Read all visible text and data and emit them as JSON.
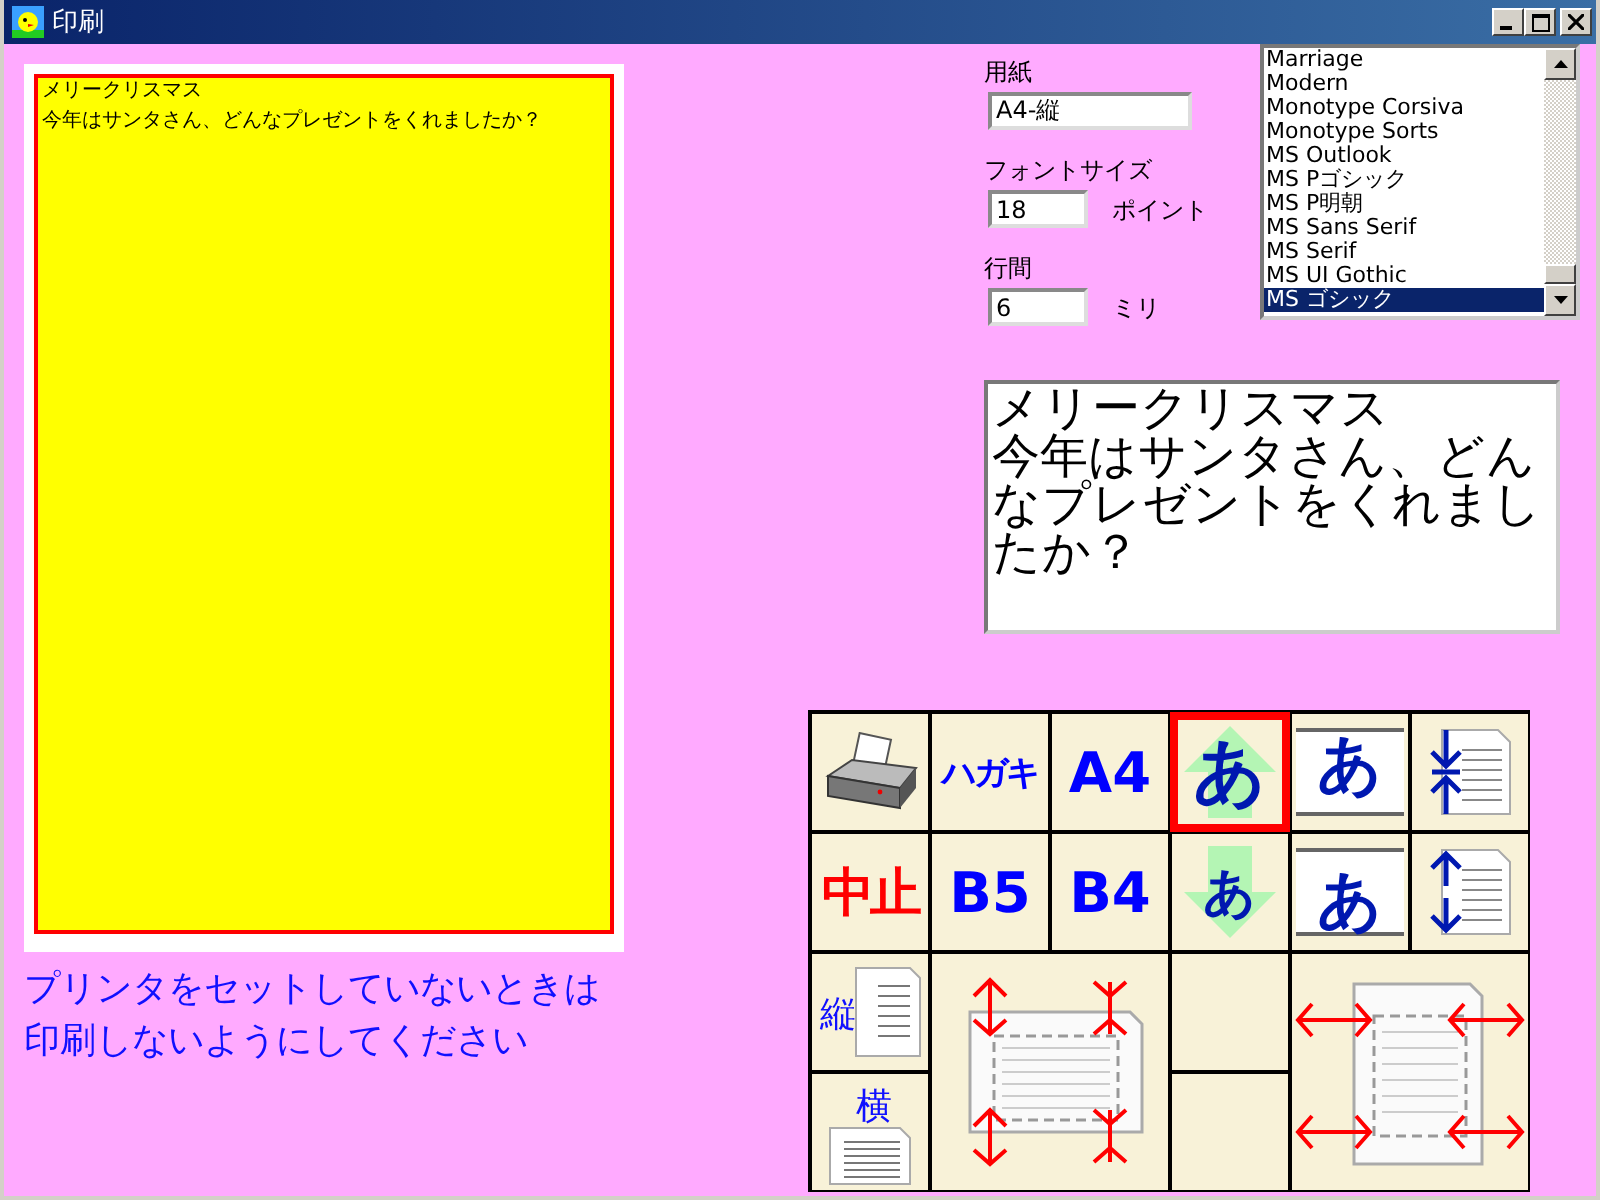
{
  "window": {
    "title": "印刷"
  },
  "preview": {
    "lines": [
      "メリークリスマス",
      "今年はサンタさん、どんなプレゼントをくれましたか？"
    ]
  },
  "note": [
    "プリンタをセットしていないときは",
    "印刷しないようにしてください"
  ],
  "paper": {
    "label": "用紙",
    "value": "A4-縦"
  },
  "font_size": {
    "label": "フォントサイズ",
    "value": "18",
    "unit": "ポイント"
  },
  "line_spacing": {
    "label": "行間",
    "value": "6",
    "unit": "ミリ"
  },
  "font_list": [
    {
      "label": "Marriage",
      "selected": false
    },
    {
      "label": "Modern",
      "selected": false
    },
    {
      "label": "Monotype Corsiva",
      "selected": false
    },
    {
      "label": "Monotype Sorts",
      "selected": false
    },
    {
      "label": "MS Outlook",
      "selected": false
    },
    {
      "label": "MS Pゴシック",
      "selected": false
    },
    {
      "label": "MS P明朝",
      "selected": false
    },
    {
      "label": "MS Sans Serif",
      "selected": false
    },
    {
      "label": "MS Serif",
      "selected": false
    },
    {
      "label": "MS UI Gothic",
      "selected": false
    },
    {
      "label": "MS ゴシック",
      "selected": true
    }
  ],
  "message": {
    "lines": [
      "メリークリスマス",
      "今年はサンタさん、どんなプレゼントをくれましたか？"
    ]
  },
  "tools": [
    {
      "kind": "printer",
      "selected": false
    },
    {
      "kind": "text",
      "label": "ハガキ",
      "selected": false
    },
    {
      "kind": "bold",
      "label": "A4",
      "selected": false
    },
    {
      "kind": "size-up",
      "label": "あ",
      "selected": true
    },
    {
      "kind": "align-top",
      "label": "あ",
      "selected": false
    },
    {
      "kind": "shrink",
      "selected": false
    },
    {
      "kind": "stop",
      "label": "中止",
      "selected": false
    },
    {
      "kind": "bold",
      "label": "B5",
      "selected": false
    },
    {
      "kind": "bold",
      "label": "B4",
      "selected": false
    },
    {
      "kind": "size-down",
      "label": "あ",
      "selected": false
    },
    {
      "kind": "align-bottom",
      "label": "あ",
      "selected": false
    },
    {
      "kind": "expand",
      "selected": false
    },
    {
      "kind": "portrait",
      "label": "縦",
      "selected": false
    },
    {
      "kind": "margin-v",
      "selected": false
    },
    {
      "kind": "blank"
    },
    {
      "kind": "margin-h",
      "selected": false
    },
    {
      "kind": "landscape",
      "label": "横",
      "selected": false
    },
    {
      "kind": "blank"
    }
  ]
}
